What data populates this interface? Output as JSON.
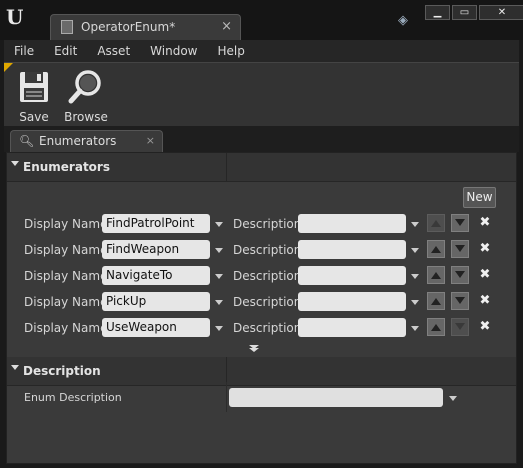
{
  "window": {
    "tab_title": "OperatorEnum*",
    "tab_close": "×",
    "minimize": "▁",
    "maximize": "▭",
    "close": "✕"
  },
  "menu": [
    "File",
    "Edit",
    "Asset",
    "Window",
    "Help"
  ],
  "toolbar": {
    "save_label": "Save",
    "browse_label": "Browse"
  },
  "panel": {
    "tab_label": "Enumerators",
    "tab_close": "×"
  },
  "enumerators_section": {
    "title": "Enumerators",
    "new_label": "New",
    "display_name_label": "Display Name",
    "description_label": "Description",
    "delete_glyph": "✖",
    "items": [
      {
        "display_name": "FindPatrolPoint",
        "description": "",
        "up_enabled": false,
        "down_enabled": true
      },
      {
        "display_name": "FindWeapon",
        "description": "",
        "up_enabled": true,
        "down_enabled": true
      },
      {
        "display_name": "NavigateTo",
        "description": "",
        "up_enabled": true,
        "down_enabled": true
      },
      {
        "display_name": "PickUp",
        "description": "",
        "up_enabled": true,
        "down_enabled": true
      },
      {
        "display_name": "UseWeapon",
        "description": "",
        "up_enabled": true,
        "down_enabled": false
      }
    ]
  },
  "description_section": {
    "title": "Description",
    "enum_description_label": "Enum Description",
    "enum_description_value": ""
  },
  "colors": {
    "accent_corner": "#e0a800",
    "panel_bg": "#3a3a3a",
    "field_bg": "#e6e6e6"
  }
}
